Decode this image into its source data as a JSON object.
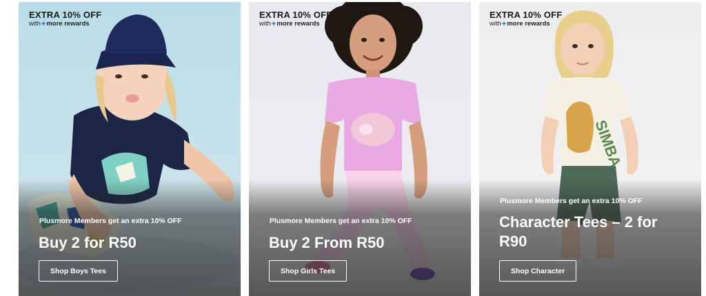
{
  "cards": [
    {
      "badge_main": "EXTRA 10% OFF",
      "badge_with": "with",
      "badge_plus": "+",
      "badge_rewards": "more rewards",
      "promo": "Plusmore Members get an extra 10% OFF",
      "headline": "Buy 2 for R50",
      "button": "Shop Boys Tees"
    },
    {
      "badge_main": "EXTRA 10% OFF",
      "badge_with": "with",
      "badge_plus": "+",
      "badge_rewards": "more rewards",
      "promo": "Plusmore Members get an extra 10% OFF",
      "headline": "Buy 2 From R50",
      "button": "Shop Girls Tees"
    },
    {
      "badge_main": "EXTRA 10% OFF",
      "badge_with": "with",
      "badge_plus": "+",
      "badge_rewards": "more rewards",
      "promo": "Plusmore Members get an extra 10% OFF",
      "headline": "Character Tees – 2 for R90",
      "button": "Shop Character",
      "tee_print": "SIMBA"
    }
  ],
  "colors": {
    "plus_accent": "#1d5fcf",
    "overlay_text": "#ffffff"
  }
}
